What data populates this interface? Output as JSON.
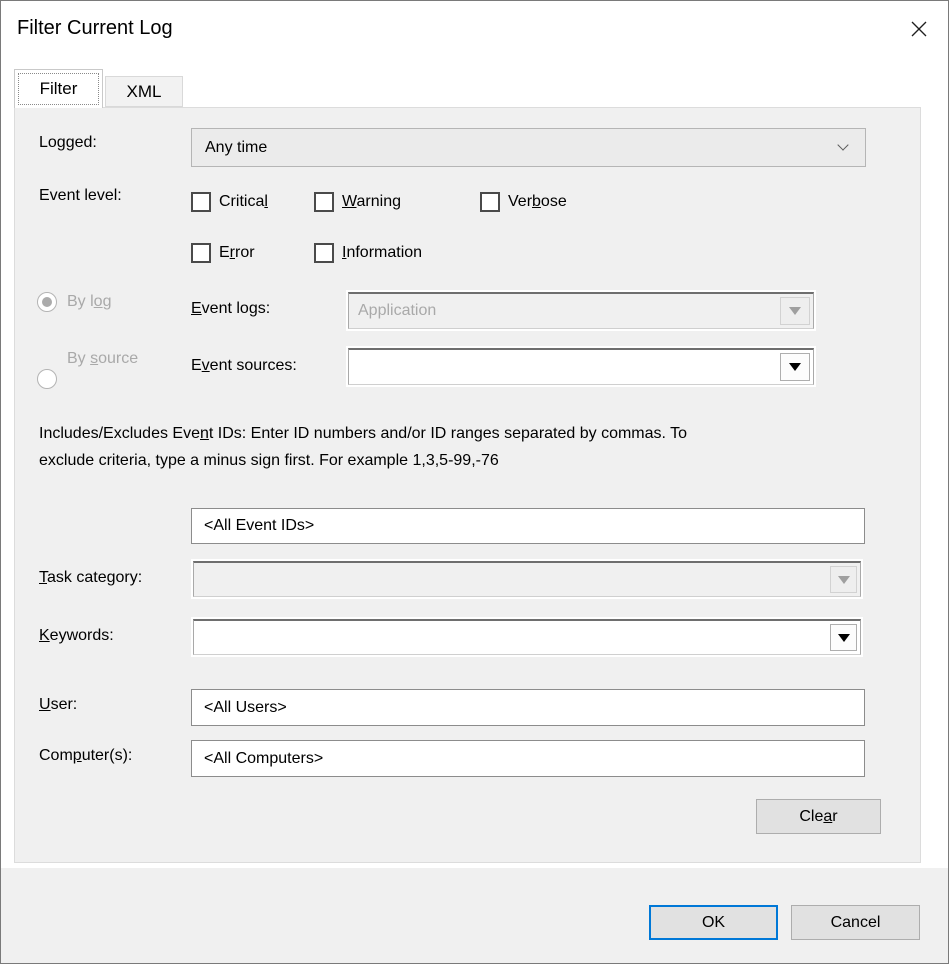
{
  "window": {
    "title": "Filter Current Log"
  },
  "icons": {
    "close": "x",
    "dropdown": "triangle-down",
    "chevron": "chevron-down"
  },
  "colors": {
    "accent": "#0078d7",
    "page_bg": "#f0f0f0",
    "disabled_text": "#a9a9a9",
    "button_bg": "#e1e1e1"
  },
  "tabs": {
    "filter": {
      "label": "Filter",
      "selected": true
    },
    "xml": {
      "label": "XML",
      "selected": false
    }
  },
  "filter": {
    "logged": {
      "label": {
        "text": "Logged:",
        "u": 2
      },
      "value": "Any time"
    },
    "event_level": {
      "label": {
        "text": "Event level:"
      },
      "critical": {
        "label": {
          "text": "Critical",
          "u": 7
        },
        "checked": false
      },
      "warning": {
        "label": {
          "text": "Warning",
          "u": 0
        },
        "checked": false
      },
      "verbose": {
        "label": {
          "text": "Verbose",
          "u": 3
        },
        "checked": false
      },
      "error": {
        "label": {
          "text": "Error",
          "u": 1
        },
        "checked": false
      },
      "information": {
        "label": {
          "text": "Information",
          "u": 0
        },
        "checked": false
      }
    },
    "by_log": {
      "label": {
        "text": "By log",
        "u": 4
      },
      "selected": true,
      "disabled": true
    },
    "by_source": {
      "label": {
        "text": "By source",
        "u": 3
      },
      "selected": false,
      "disabled": true
    },
    "event_logs": {
      "label": {
        "text": "Event logs:",
        "u": 0
      },
      "value": "Application",
      "disabled": true
    },
    "event_sources": {
      "label": {
        "text": "Event sources:",
        "u": 1
      },
      "value": "",
      "disabled": false
    },
    "event_ids": {
      "description_line1": {
        "text": "Includes/Excludes Event IDs: Enter ID numbers and/or ID ranges separated by commas. To",
        "u": 21
      },
      "description_line2": {
        "text": "exclude criteria, type a minus sign first. For example 1,3,5-99,-76"
      },
      "value": "<All Event IDs>"
    },
    "task_category": {
      "label": {
        "text": "Task category:",
        "u": 0
      },
      "value": "",
      "disabled": true
    },
    "keywords": {
      "label": {
        "text": "Keywords:",
        "u": 0
      },
      "value": "",
      "disabled": false
    },
    "user": {
      "label": {
        "text": "User:",
        "u": 0
      },
      "value": "<All Users>"
    },
    "computers": {
      "label": {
        "text": "Computer(s):",
        "u": 3
      },
      "value": "<All Computers>"
    },
    "clear_button": {
      "text": "Clear",
      "u": 3
    }
  },
  "footer": {
    "ok_label": "OK",
    "cancel_label": "Cancel"
  }
}
